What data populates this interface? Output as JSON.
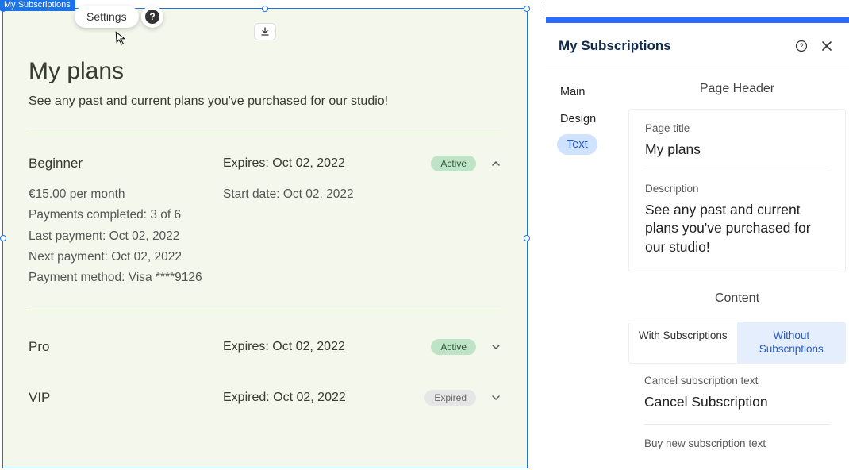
{
  "canvas": {
    "element_tag": "My Subscriptions",
    "settings_label": "Settings"
  },
  "page": {
    "title": "My plans",
    "description": "See any past and current plans you've purchased for our studio!"
  },
  "plans": [
    {
      "name": "Beginner",
      "expires_label": "Expires: Oct 02, 2022",
      "status": "Active",
      "expanded": true,
      "details_left": [
        "€15.00 per month",
        "Payments completed: 3 of 6",
        "Last payment: Oct 02, 2022",
        "Next payment: Oct 02, 2022",
        "Payment method: Visa ****9126"
      ],
      "details_right": "Start date: Oct 02, 2022"
    },
    {
      "name": "Pro",
      "expires_label": "Expires: Oct 02, 2022",
      "status": "Active",
      "expanded": false
    },
    {
      "name": "VIP",
      "expires_label": "Expired: Oct 02, 2022",
      "status": "Expired",
      "expanded": false
    }
  ],
  "sidepanel": {
    "title": "My Subscriptions",
    "nav": {
      "main": "Main",
      "design": "Design",
      "text": "Text"
    },
    "sections": {
      "header": "Page Header",
      "content": "Content"
    },
    "header_fields": {
      "title_label": "Page title",
      "title_value": "My plans",
      "desc_label": "Description",
      "desc_value": "See any past and current plans you've purchased for our studio!"
    },
    "content_tabs": {
      "with": "With Subscriptions",
      "without": "Without Subscriptions"
    },
    "content_fields": {
      "cancel_label": "Cancel subscription text",
      "cancel_value": "Cancel Subscription",
      "buy_label": "Buy new subscription text"
    }
  }
}
